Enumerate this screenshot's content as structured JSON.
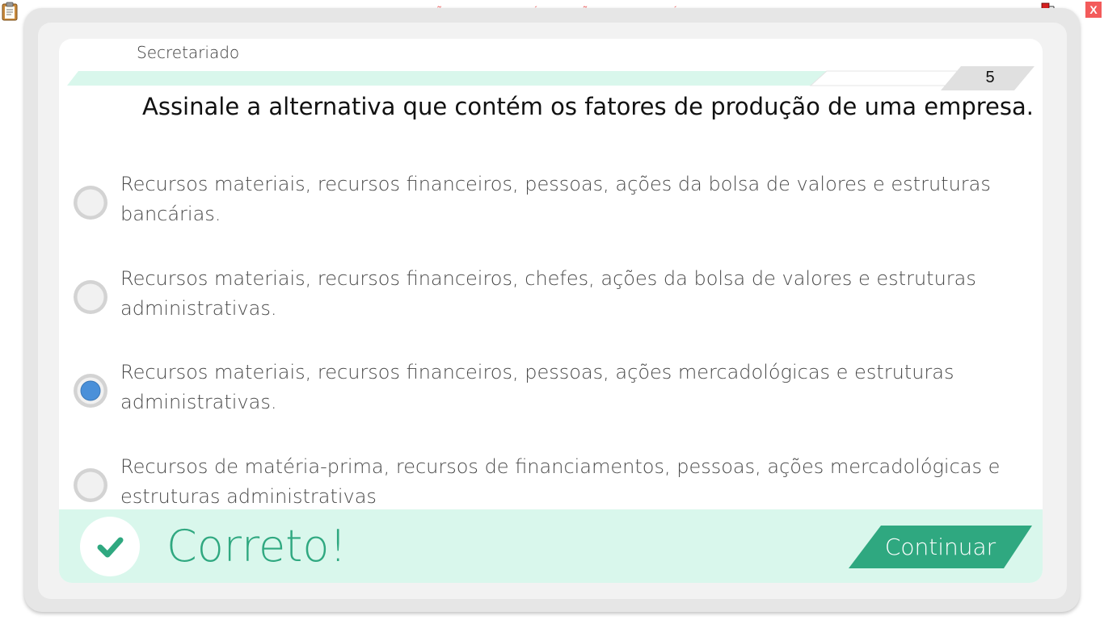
{
  "window": {
    "watermark": "VERSÃO PARA FUNCIONÁRIOS - NÃO COMERCIALIZÁVEL",
    "close_label": "X",
    "icons": {
      "left": "clipboard-icon",
      "right": "network-monitor-icon"
    }
  },
  "quiz": {
    "subject": "Secretariado",
    "question_number": "5",
    "question": "Assinale a alternativa que contém os fatores de produção de uma empresa.",
    "selected_option": 2,
    "options": [
      {
        "text": "Recursos materiais, recursos financeiros, pessoas, ações da bolsa de valores e estruturas bancárias."
      },
      {
        "text": "Recursos materiais, recursos financeiros, chefes, ações da bolsa de valores e estruturas administrativas."
      },
      {
        "text": "Recursos materiais, recursos financeiros, pessoas, ações mercadológicas e estruturas administrativas."
      },
      {
        "text": "Recursos de matéria-prima, recursos de financiamentos, pessoas, ações mercadológicas e estruturas administrativas"
      }
    ]
  },
  "feedback": {
    "result": "Correto!",
    "continue_label": "Continuar",
    "icon": "check-icon"
  },
  "colors": {
    "accent_green": "#2fa880",
    "feedback_bg": "#d9f7ec",
    "progress_bar": "#d9f7ec",
    "radio_selected": "#4a90d9",
    "watermark": "#f05a5a",
    "close": "#f35b5b"
  }
}
